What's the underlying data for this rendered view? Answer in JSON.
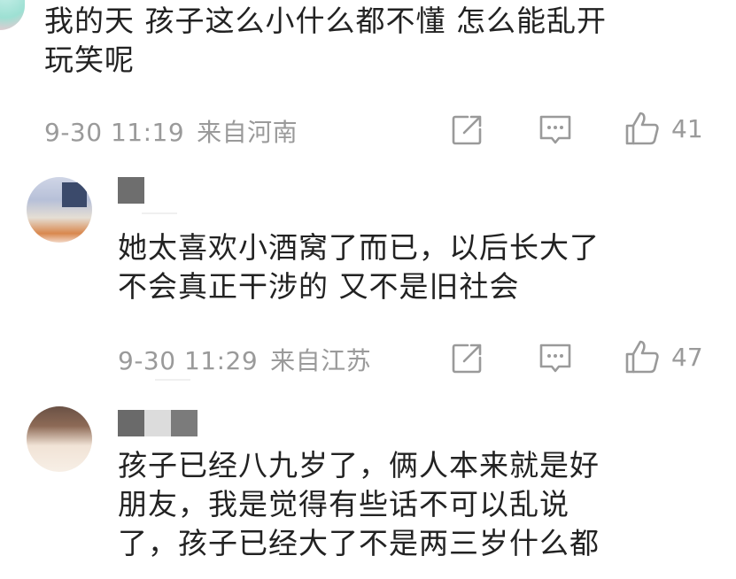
{
  "comments": [
    {
      "text": "我的天 孩子这么小什么都不懂 怎么能乱开玩笑呢",
      "line1": "我的天 孩子这么小什么都不懂 怎么能乱开",
      "line2": "玩笑呢",
      "time": "9-30 11:19",
      "location": "来自河南",
      "likes": "41"
    },
    {
      "line1": "她太喜欢小酒窝了而已，以后长大了",
      "line2": "不会真正干涉的 又不是旧社会",
      "time": "9-30 11:29",
      "location": "来自江苏",
      "likes": "47"
    },
    {
      "line1": "孩子已经八九岁了，俩人本来就是好",
      "line2": "朋友，我是觉得有些话不可以乱说",
      "line3": "了，孩子已经大了不是两三岁什么都"
    }
  ],
  "icons": {
    "share": "share-icon",
    "reply": "comment-icon",
    "like": "thumbs-up-icon"
  },
  "colors": {
    "text": "#222222",
    "meta": "#9a9a9a",
    "background": "#ffffff"
  }
}
